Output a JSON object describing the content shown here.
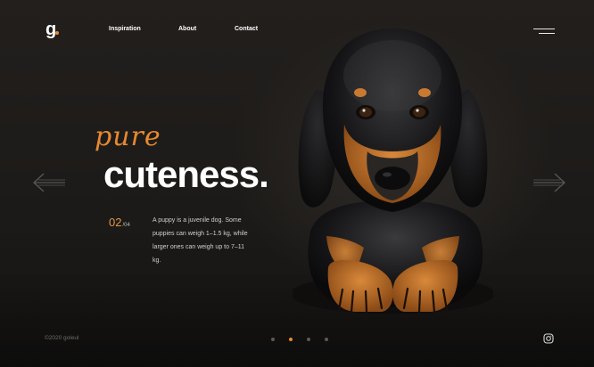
{
  "brand": {
    "logo_text": "g",
    "accent_color": "#e8892f"
  },
  "nav": {
    "items": [
      {
        "label": "Inspiration"
      },
      {
        "label": "About"
      },
      {
        "label": "Contact"
      }
    ],
    "menu_icon": "hamburger-menu-icon"
  },
  "hero": {
    "script_word": "pure",
    "headline": "cuteness.",
    "slide_current": "02",
    "slide_total": "/04",
    "description": "A puppy is a juvenile dog. Some puppies can weigh 1–1.5 kg, while larger ones can weigh up to 7–11 kg.",
    "prev_icon": "arrow-left-icon",
    "next_icon": "arrow-right-icon",
    "image": "dachshund-puppy-image"
  },
  "footer": {
    "copyright": "©2020 goleul",
    "social_icon": "instagram-icon"
  },
  "pagination": {
    "count": 4,
    "active_index": 1,
    "active_color": "#e8892f",
    "inactive_color": "#5a5a5a"
  }
}
